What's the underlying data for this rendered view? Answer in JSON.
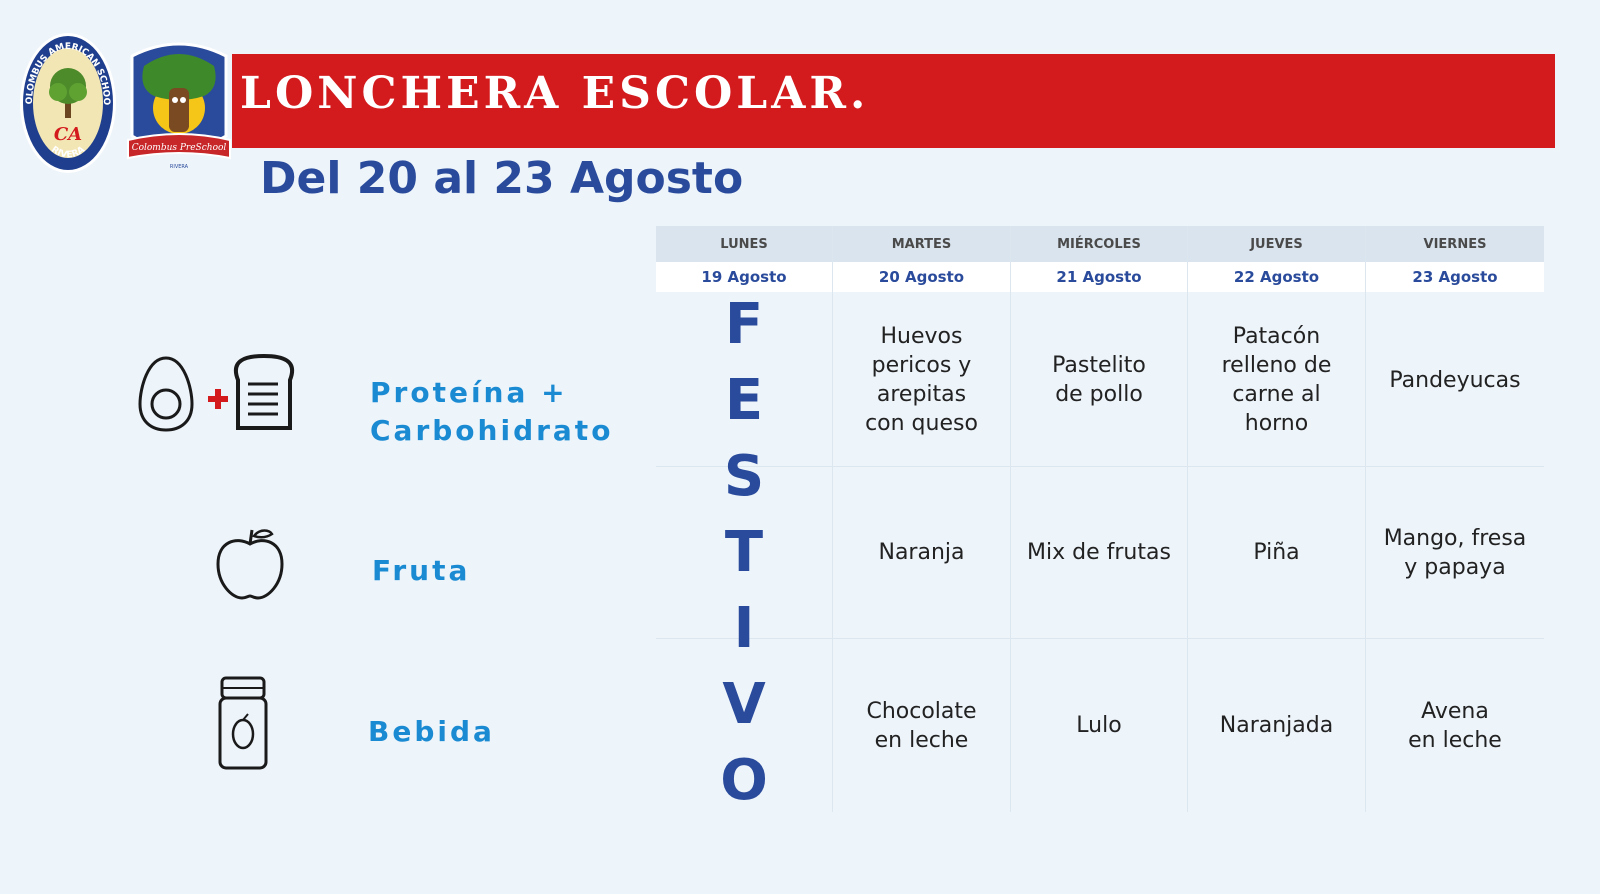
{
  "header": {
    "title": "LONCHERA ESCOLAR.",
    "subtitle": "Del 20 al 23 Agosto"
  },
  "logos": {
    "school_ring_top": "COLOMBUS AMERICAN SCHOOL",
    "school_ring_bottom": "RIVERA",
    "school_initials": "CA",
    "preschool_name": "Colombus PreSchool",
    "preschool_place": "RIVERA"
  },
  "categories": [
    {
      "label_lines": [
        "Proteína +",
        "Carbohidrato"
      ],
      "icon": "egg-toast-icon"
    },
    {
      "label_lines": [
        "Fruta"
      ],
      "icon": "apple-icon"
    },
    {
      "label_lines": [
        "Bebida"
      ],
      "icon": "bottle-icon"
    }
  ],
  "days": [
    {
      "day": "LUNES",
      "date": "19 Agosto"
    },
    {
      "day": "MARTES",
      "date": "20 Agosto"
    },
    {
      "day": "MIÉRCOLES",
      "date": "21 Agosto"
    },
    {
      "day": "JUEVES",
      "date": "22 Agosto"
    },
    {
      "day": "VIERNES",
      "date": "23 Agosto"
    }
  ],
  "holiday": {
    "letters": [
      "F",
      "E",
      "S",
      "T",
      "I",
      "V",
      "O"
    ]
  },
  "menu": [
    {
      "day": "MARTES",
      "items": [
        [
          "Huevos",
          "pericos y",
          "arepitas",
          "con queso"
        ],
        [
          "Naranja"
        ],
        [
          "Chocolate",
          "en leche"
        ]
      ]
    },
    {
      "day": "MIÉRCOLES",
      "items": [
        [
          "Pastelito",
          "de pollo"
        ],
        [
          "Mix de frutas"
        ],
        [
          "Lulo"
        ]
      ]
    },
    {
      "day": "JUEVES",
      "items": [
        [
          "Patacón",
          "relleno de",
          "carne al",
          "horno"
        ],
        [
          "Piña"
        ],
        [
          "Naranjada"
        ]
      ]
    },
    {
      "day": "VIERNES",
      "items": [
        [
          "Pandeyucas"
        ],
        [
          "Mango, fresa",
          "y papaya"
        ],
        [
          "Avena",
          "en leche"
        ]
      ]
    }
  ],
  "colors": {
    "banner": "#d31a1d",
    "subtitle": "#2a4b9b",
    "category": "#1a8ad2",
    "background": "#edf4fa"
  }
}
